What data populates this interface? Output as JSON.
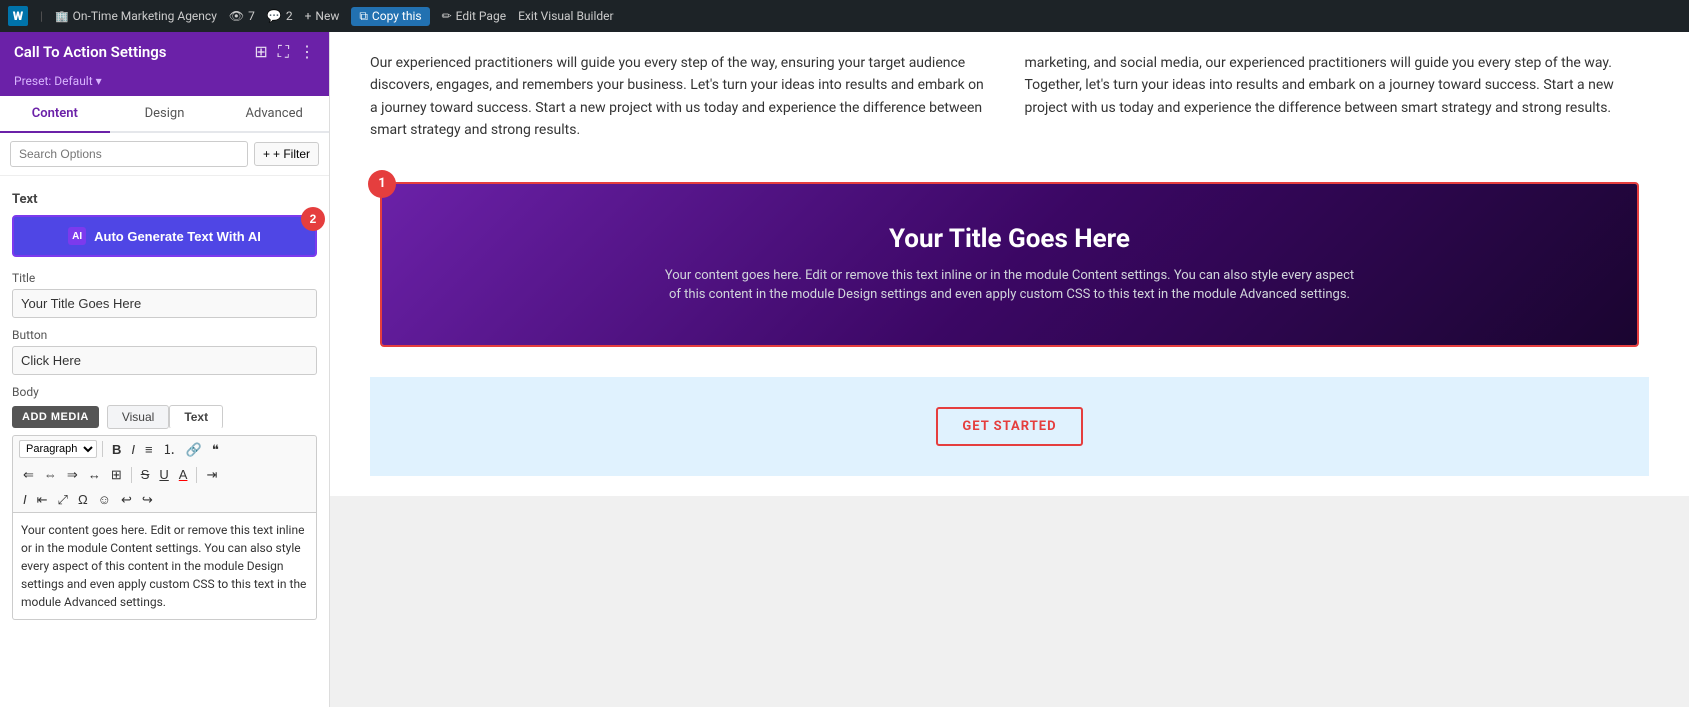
{
  "adminBar": {
    "wpLogo": "⊞",
    "agencyName": "On-Time Marketing Agency",
    "eyeCount": "7",
    "commentCount": "2",
    "newLabel": "New",
    "copyLabel": "Copy this",
    "editLabel": "Edit Page",
    "exitLabel": "Exit Visual Builder"
  },
  "sidebar": {
    "title": "Call To Action Settings",
    "preset": "Preset: Default ▾",
    "tabs": [
      "Content",
      "Design",
      "Advanced"
    ],
    "activeTab": "Content",
    "search": {
      "placeholder": "Search Options",
      "filterLabel": "Filter"
    },
    "textSection": {
      "label": "Text",
      "aiButton": "Auto Generate Text With AI",
      "badge": "2"
    },
    "titleSection": {
      "label": "Title",
      "value": "Your Title Goes Here"
    },
    "buttonSection": {
      "label": "Button",
      "value": "Click Here"
    },
    "bodySection": {
      "label": "Body",
      "addMediaLabel": "ADD MEDIA",
      "visualTab": "Visual",
      "textTab": "Text",
      "paragraphOption": "Paragraph",
      "bodyText": "Your content goes here. Edit or remove this text inline or in the module Content settings. You can also style every aspect of this content in the module Design settings and even apply custom CSS to this text in the module Advanced settings."
    }
  },
  "mainContent": {
    "leftColumn": "Our experienced practitioners will guide you every step of the way, ensuring your target audience discovers, engages, and remembers your business. Let's turn your ideas into results and embark on a journey toward success. Start a new project with us today and experience the difference between smart strategy and strong results.",
    "rightColumn": "marketing, and social media, our experienced practitioners will guide you every step of the way. Together, let's turn your ideas into results and embark on a journey toward success. Start a new project with us today and experience the difference between smart strategy and strong results.",
    "ctaBadge": "1",
    "cta": {
      "title": "Your Title Goes Here",
      "body": "Your content goes here. Edit or remove this text inline or in the module Content settings. You can also style every aspect of this content in the module Design settings and even apply custom CSS to this text in the module Advanced settings."
    },
    "bottomCta": {
      "buttonLabel": "GET STARTED"
    }
  },
  "icons": {
    "wordpress": "W",
    "eye": "👁",
    "comment": "💬",
    "plus": "+",
    "copy": "⧉",
    "edit": "✏",
    "duplicate": "⊞",
    "kebab": "⋮",
    "fullscreen": "⛶",
    "close": "✕",
    "ai": "AI",
    "bold": "B",
    "italic": "I",
    "ul": "≡",
    "ol": "⒈",
    "link": "🔗",
    "quote": "❝",
    "alignLeft": "⇐",
    "alignCenter": "⇔",
    "alignRight": "⇒",
    "alignJustify": "↔",
    "table": "⊞",
    "strikethrough": "S̶",
    "underline": "U̲",
    "colorPicker": "A",
    "indent": "→",
    "specialChar": "Ω",
    "emoji": "☺",
    "undo": "↩",
    "redo": "↪",
    "italic2": "I",
    "indent2": "⇥",
    "outdent": "⇤",
    "expand": "⤢",
    "filterIcon": "+ Filter"
  }
}
